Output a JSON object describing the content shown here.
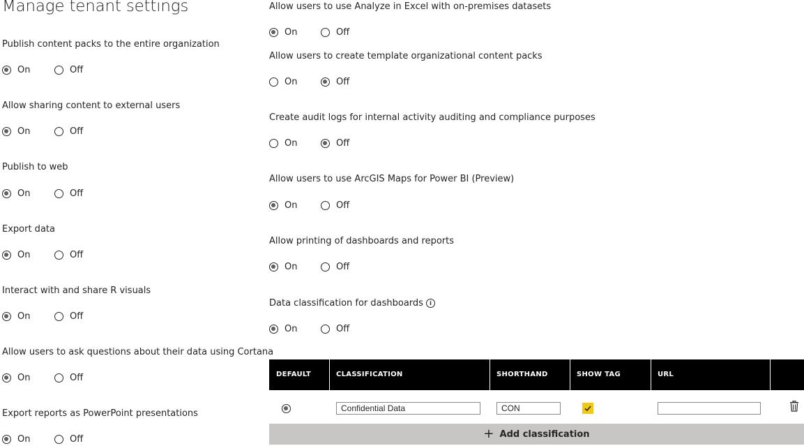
{
  "page": {
    "title": "Manage tenant settings"
  },
  "labels": {
    "on": "On",
    "off": "Off"
  },
  "left_settings": [
    {
      "label": "Publish content packs to the entire organization",
      "value": "On"
    },
    {
      "label": "Allow sharing content to external users",
      "value": "On"
    },
    {
      "label": "Publish to web",
      "value": "On"
    },
    {
      "label": "Export data",
      "value": "On"
    },
    {
      "label": "Interact with and share R visuals",
      "value": "On"
    },
    {
      "label": "Allow users to ask questions about their data using Cortana",
      "value": "On"
    },
    {
      "label": "Export reports as PowerPoint presentations",
      "value": "On"
    }
  ],
  "right_settings": [
    {
      "label": "Allow users to use Analyze in Excel with on-premises datasets",
      "value": "On"
    },
    {
      "label": "Allow users to create template organizational content packs",
      "value": "Off"
    },
    {
      "label": "Create audit logs for internal activity auditing and compliance purposes",
      "value": "Off"
    },
    {
      "label": "Allow users to use ArcGIS Maps for Power BI (Preview)",
      "value": "On"
    },
    {
      "label": "Allow printing of dashboards and reports",
      "value": "On"
    },
    {
      "label": "Data classification for dashboards",
      "value": "On",
      "info_icon": "info-icon"
    }
  ],
  "classification_table": {
    "headers": [
      "DEFAULT",
      "CLASSIFICATION",
      "SHORTHAND",
      "SHOW TAG",
      "URL"
    ],
    "rows": [
      {
        "default": true,
        "classification": "Confidential Data",
        "shorthand": "CON",
        "show_tag": true,
        "url": ""
      }
    ],
    "add_label": "Add classification",
    "add_icon": "plus-icon",
    "delete_icon": "trash-icon",
    "checkbox_color": "#f2c811"
  }
}
